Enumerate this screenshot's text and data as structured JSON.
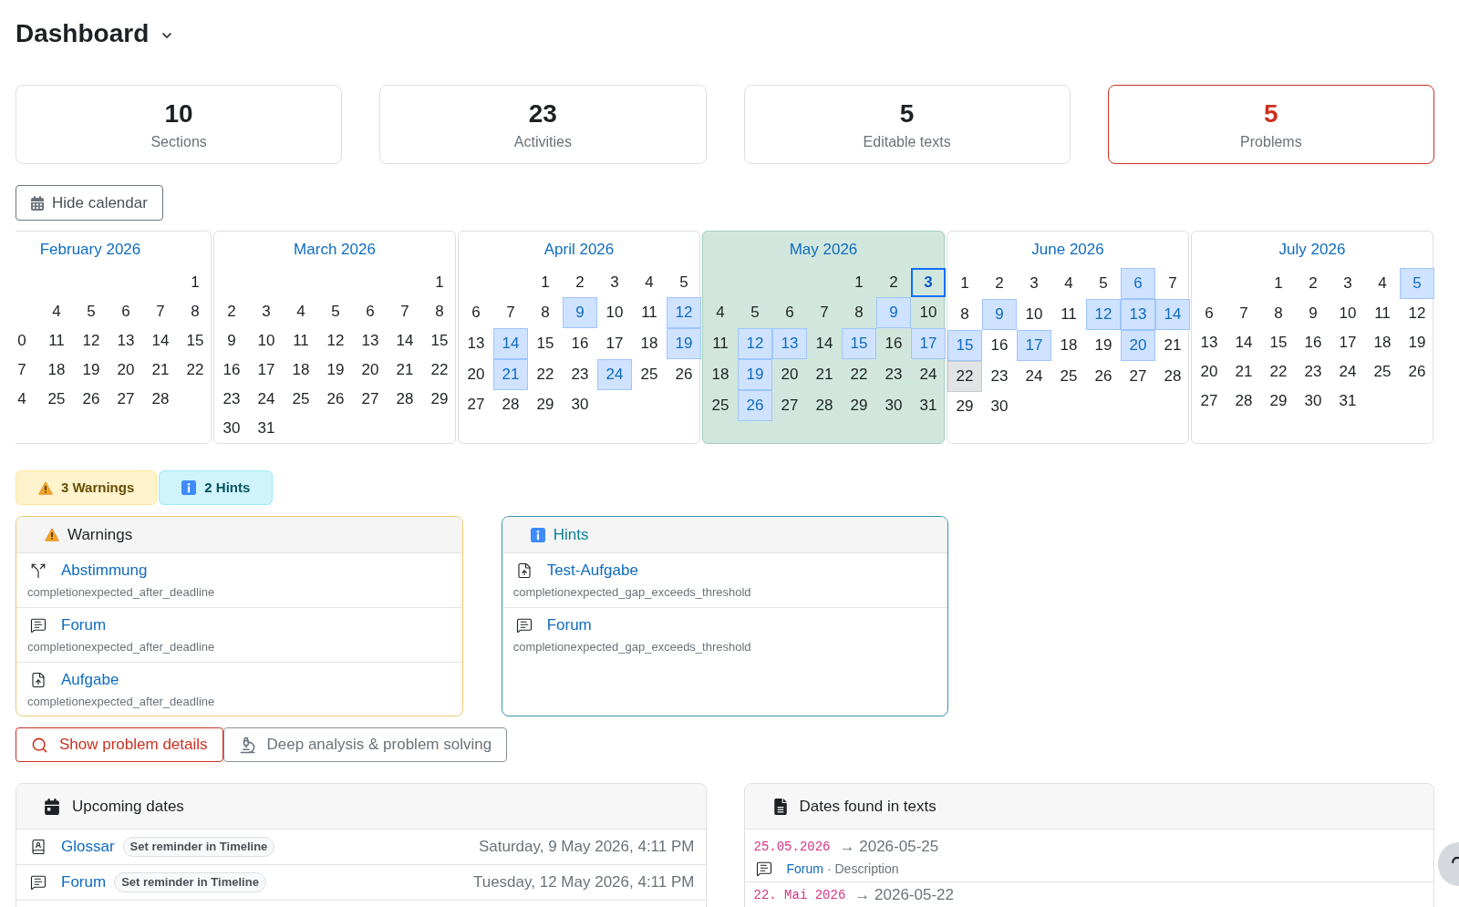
{
  "header": {
    "title": "Dashboard"
  },
  "stats": [
    {
      "value": "10",
      "label": "Sections",
      "alert": false
    },
    {
      "value": "23",
      "label": "Activities",
      "alert": false
    },
    {
      "value": "5",
      "label": "Editable texts",
      "alert": false
    },
    {
      "value": "5",
      "label": "Problems",
      "alert": true
    }
  ],
  "calendar_toggle": {
    "label": "Hide calendar"
  },
  "calendar": {
    "months": [
      {
        "title": "February 2026",
        "current": false,
        "weeks": [
          [
            {
              "day": "1",
              "kind": "day"
            }
          ],
          [
            {
              "day": "4",
              "kind": "day"
            },
            {
              "day": "5",
              "kind": "day"
            },
            {
              "day": "6",
              "kind": "day"
            },
            {
              "day": "7",
              "kind": "day"
            },
            {
              "day": "8",
              "kind": "day"
            }
          ],
          [
            {
              "day": "0",
              "kind": "day"
            },
            {
              "day": "11",
              "kind": "day"
            },
            {
              "day": "12",
              "kind": "day"
            },
            {
              "day": "13",
              "kind": "day"
            },
            {
              "day": "14",
              "kind": "day"
            },
            {
              "day": "15",
              "kind": "day"
            }
          ],
          [
            {
              "day": "7",
              "kind": "day"
            },
            {
              "day": "18",
              "kind": "day"
            },
            {
              "day": "19",
              "kind": "day"
            },
            {
              "day": "20",
              "kind": "day"
            },
            {
              "day": "21",
              "kind": "day"
            },
            {
              "day": "22",
              "kind": "day"
            }
          ],
          [
            {
              "day": "4",
              "kind": "day"
            },
            {
              "day": "25",
              "kind": "day"
            },
            {
              "day": "26",
              "kind": "day"
            },
            {
              "day": "27",
              "kind": "day"
            },
            {
              "day": "28",
              "kind": "day"
            }
          ]
        ]
      },
      {
        "title": "March 2026",
        "current": false,
        "weeks": [
          [
            {
              "day": "1",
              "kind": "day"
            }
          ],
          [
            {
              "day": "2",
              "kind": "day"
            },
            {
              "day": "3",
              "kind": "day"
            },
            {
              "day": "4",
              "kind": "day"
            },
            {
              "day": "5",
              "kind": "day"
            },
            {
              "day": "6",
              "kind": "day"
            },
            {
              "day": "7",
              "kind": "day"
            },
            {
              "day": "8",
              "kind": "day"
            }
          ],
          [
            {
              "day": "9",
              "kind": "day"
            },
            {
              "day": "10",
              "kind": "day"
            },
            {
              "day": "11",
              "kind": "day"
            },
            {
              "day": "12",
              "kind": "day"
            },
            {
              "day": "13",
              "kind": "day"
            },
            {
              "day": "14",
              "kind": "day"
            },
            {
              "day": "15",
              "kind": "day"
            }
          ],
          [
            {
              "day": "16",
              "kind": "day"
            },
            {
              "day": "17",
              "kind": "day"
            },
            {
              "day": "18",
              "kind": "day"
            },
            {
              "day": "19",
              "kind": "day"
            },
            {
              "day": "20",
              "kind": "day"
            },
            {
              "day": "21",
              "kind": "day"
            },
            {
              "day": "22",
              "kind": "day"
            }
          ],
          [
            {
              "day": "23",
              "kind": "day"
            },
            {
              "day": "24",
              "kind": "day"
            },
            {
              "day": "25",
              "kind": "day"
            },
            {
              "day": "26",
              "kind": "day"
            },
            {
              "day": "27",
              "kind": "day"
            },
            {
              "day": "28",
              "kind": "day"
            },
            {
              "day": "29",
              "kind": "day"
            }
          ],
          [
            {
              "day": "30",
              "kind": "day"
            },
            {
              "day": "31",
              "kind": "day"
            }
          ]
        ]
      },
      {
        "title": "April 2026",
        "current": false,
        "weeks": [
          [
            {
              "day": "1",
              "kind": "day"
            },
            {
              "day": "2",
              "kind": "day"
            },
            {
              "day": "3",
              "kind": "day"
            },
            {
              "day": "4",
              "kind": "day"
            },
            {
              "day": "5",
              "kind": "day"
            }
          ],
          [
            {
              "day": "6",
              "kind": "day"
            },
            {
              "day": "7",
              "kind": "day"
            },
            {
              "day": "8",
              "kind": "day"
            },
            {
              "day": "9",
              "kind": "event"
            },
            {
              "day": "10",
              "kind": "day"
            },
            {
              "day": "11",
              "kind": "day"
            },
            {
              "day": "12",
              "kind": "event"
            }
          ],
          [
            {
              "day": "13",
              "kind": "day"
            },
            {
              "day": "14",
              "kind": "event"
            },
            {
              "day": "15",
              "kind": "day"
            },
            {
              "day": "16",
              "kind": "day"
            },
            {
              "day": "17",
              "kind": "day"
            },
            {
              "day": "18",
              "kind": "day"
            },
            {
              "day": "19",
              "kind": "event"
            }
          ],
          [
            {
              "day": "20",
              "kind": "day"
            },
            {
              "day": "21",
              "kind": "event"
            },
            {
              "day": "22",
              "kind": "day"
            },
            {
              "day": "23",
              "kind": "day"
            },
            {
              "day": "24",
              "kind": "event"
            },
            {
              "day": "25",
              "kind": "day"
            },
            {
              "day": "26",
              "kind": "day"
            }
          ],
          [
            {
              "day": "27",
              "kind": "day"
            },
            {
              "day": "28",
              "kind": "day"
            },
            {
              "day": "29",
              "kind": "day"
            },
            {
              "day": "30",
              "kind": "day"
            }
          ]
        ]
      },
      {
        "title": "May 2026",
        "current": true,
        "weeks": [
          [
            {
              "day": "1",
              "kind": "day"
            },
            {
              "day": "2",
              "kind": "day"
            },
            {
              "day": "3",
              "kind": "today"
            }
          ],
          [
            {
              "day": "4",
              "kind": "day"
            },
            {
              "day": "5",
              "kind": "day"
            },
            {
              "day": "6",
              "kind": "day"
            },
            {
              "day": "7",
              "kind": "day"
            },
            {
              "day": "8",
              "kind": "day"
            },
            {
              "day": "9",
              "kind": "event"
            },
            {
              "day": "10",
              "kind": "day"
            }
          ],
          [
            {
              "day": "11",
              "kind": "day"
            },
            {
              "day": "12",
              "kind": "event"
            },
            {
              "day": "13",
              "kind": "event"
            },
            {
              "day": "14",
              "kind": "day"
            },
            {
              "day": "15",
              "kind": "event"
            },
            {
              "day": "16",
              "kind": "day"
            },
            {
              "day": "17",
              "kind": "event"
            }
          ],
          [
            {
              "day": "18",
              "kind": "day"
            },
            {
              "day": "19",
              "kind": "event"
            },
            {
              "day": "20",
              "kind": "day"
            },
            {
              "day": "21",
              "kind": "day"
            },
            {
              "day": "22",
              "kind": "day"
            },
            {
              "day": "23",
              "kind": "day"
            },
            {
              "day": "24",
              "kind": "day"
            }
          ],
          [
            {
              "day": "25",
              "kind": "day"
            },
            {
              "day": "26",
              "kind": "event"
            },
            {
              "day": "27",
              "kind": "day"
            },
            {
              "day": "28",
              "kind": "day"
            },
            {
              "day": "29",
              "kind": "day"
            },
            {
              "day": "30",
              "kind": "day"
            },
            {
              "day": "31",
              "kind": "day"
            }
          ]
        ]
      },
      {
        "title": "June 2026",
        "current": false,
        "weeks": [
          [
            {
              "day": "1",
              "kind": "day"
            },
            {
              "day": "2",
              "kind": "day"
            },
            {
              "day": "3",
              "kind": "day"
            },
            {
              "day": "4",
              "kind": "day"
            },
            {
              "day": "5",
              "kind": "day"
            },
            {
              "day": "6",
              "kind": "event"
            },
            {
              "day": "7",
              "kind": "day"
            }
          ],
          [
            {
              "day": "8",
              "kind": "day"
            },
            {
              "day": "9",
              "kind": "event"
            },
            {
              "day": "10",
              "kind": "day"
            },
            {
              "day": "11",
              "kind": "day"
            },
            {
              "day": "12",
              "kind": "event"
            },
            {
              "day": "13",
              "kind": "event"
            },
            {
              "day": "14",
              "kind": "event"
            }
          ],
          [
            {
              "day": "15",
              "kind": "event"
            },
            {
              "day": "16",
              "kind": "day"
            },
            {
              "day": "17",
              "kind": "event"
            },
            {
              "day": "18",
              "kind": "day"
            },
            {
              "day": "19",
              "kind": "day"
            },
            {
              "day": "20",
              "kind": "event"
            },
            {
              "day": "21",
              "kind": "day"
            }
          ],
          [
            {
              "day": "22",
              "kind": "shaded"
            },
            {
              "day": "23",
              "kind": "day"
            },
            {
              "day": "24",
              "kind": "day"
            },
            {
              "day": "25",
              "kind": "day"
            },
            {
              "day": "26",
              "kind": "day"
            },
            {
              "day": "27",
              "kind": "day"
            },
            {
              "day": "28",
              "kind": "day"
            }
          ],
          [
            {
              "day": "29",
              "kind": "day"
            },
            {
              "day": "30",
              "kind": "day"
            }
          ]
        ]
      },
      {
        "title": "July 2026",
        "current": false,
        "weeks": [
          [
            {
              "day": "1",
              "kind": "day"
            },
            {
              "day": "2",
              "kind": "day"
            },
            {
              "day": "3",
              "kind": "day"
            },
            {
              "day": "4",
              "kind": "day"
            },
            {
              "day": "5",
              "kind": "event"
            }
          ],
          [
            {
              "day": "6",
              "kind": "day"
            },
            {
              "day": "7",
              "kind": "day"
            },
            {
              "day": "8",
              "kind": "day"
            },
            {
              "day": "9",
              "kind": "day"
            },
            {
              "day": "10",
              "kind": "day"
            },
            {
              "day": "11",
              "kind": "day"
            },
            {
              "day": "12",
              "kind": "day"
            }
          ],
          [
            {
              "day": "13",
              "kind": "day"
            },
            {
              "day": "14",
              "kind": "day"
            },
            {
              "day": "15",
              "kind": "day"
            },
            {
              "day": "16",
              "kind": "day"
            },
            {
              "day": "17",
              "kind": "day"
            },
            {
              "day": "18",
              "kind": "day"
            },
            {
              "day": "19",
              "kind": "day"
            }
          ],
          [
            {
              "day": "20",
              "kind": "day"
            },
            {
              "day": "21",
              "kind": "day"
            },
            {
              "day": "22",
              "kind": "day"
            },
            {
              "day": "23",
              "kind": "day"
            },
            {
              "day": "24",
              "kind": "day"
            },
            {
              "day": "25",
              "kind": "day"
            },
            {
              "day": "26",
              "kind": "day"
            }
          ],
          [
            {
              "day": "27",
              "kind": "day"
            },
            {
              "day": "28",
              "kind": "day"
            },
            {
              "day": "29",
              "kind": "day"
            },
            {
              "day": "30",
              "kind": "day"
            },
            {
              "day": "31",
              "kind": "day"
            }
          ]
        ]
      }
    ]
  },
  "problem_badges": [
    {
      "kind": "warning",
      "label": "3 Warnings"
    },
    {
      "kind": "hint",
      "label": "2 Hints"
    }
  ],
  "problem_panels": [
    {
      "kind": "warning",
      "title": "Warnings",
      "items": [
        {
          "kind": "choice",
          "name": "Abstimmung",
          "code": "completionexpected_after_deadline"
        },
        {
          "kind": "forum",
          "name": "Forum",
          "code": "completionexpected_after_deadline"
        },
        {
          "kind": "assign",
          "name": "Aufgabe",
          "code": "completionexpected_after_deadline"
        }
      ]
    },
    {
      "kind": "hint",
      "title": "Hints",
      "items": [
        {
          "kind": "assign",
          "name": "Test-Aufgabe",
          "code": "completionexpected_gap_exceeds_threshold"
        },
        {
          "kind": "forum",
          "name": "Forum",
          "code": "completionexpected_gap_exceeds_threshold"
        }
      ]
    }
  ],
  "actions": [
    {
      "kind": "danger",
      "label": "Show problem details"
    },
    {
      "kind": "secondary",
      "label": "Deep analysis & problem solving"
    }
  ],
  "upcoming": {
    "title": "Upcoming dates",
    "rows": [
      {
        "kind": "glossary",
        "name": "Glossar",
        "badge": "Set reminder in Timeline",
        "date": "Saturday, 9 May 2026, 4:11 PM"
      },
      {
        "kind": "forum",
        "name": "Forum",
        "badge": "Set reminder in Timeline",
        "date": "Tuesday, 12 May 2026, 4:11 PM"
      }
    ]
  },
  "found_dates": {
    "title": "Dates found in texts",
    "rows": [
      {
        "match": "25.05.2026",
        "normalized": "→ 2026-05-25",
        "source": {
          "kind": "forum",
          "name": "Forum",
          "field": "· Description"
        }
      },
      {
        "match": "22. Mai 2026",
        "normalized": "→ 2026-05-22"
      }
    ]
  }
}
